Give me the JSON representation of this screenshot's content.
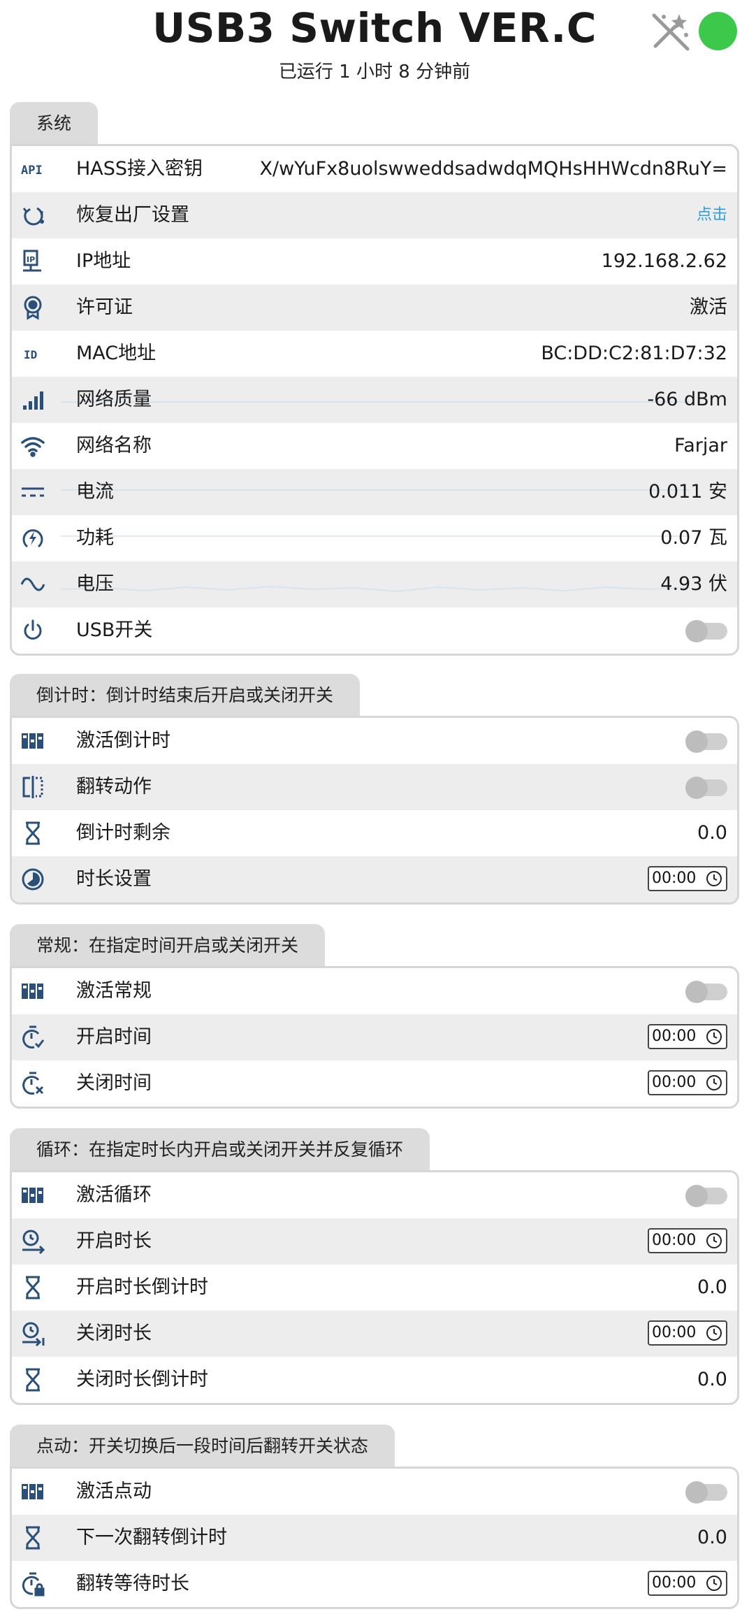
{
  "header": {
    "title": "USB3 Switch VER.C",
    "uptime": "已运行 1 小时 8 分钟前",
    "status_color": "#3cc84b"
  },
  "system": {
    "tab": "系统",
    "rows": [
      {
        "icon": "api-icon",
        "label": "HASS接入密钥",
        "value": "X/wYuFx8uolswweddsadwdqMQHsHHWcdn8RuY="
      },
      {
        "icon": "restore-icon",
        "label": "恢复出厂设置",
        "value": "点击"
      },
      {
        "icon": "ip-icon",
        "label": "IP地址",
        "value": "192.168.2.62"
      },
      {
        "icon": "license-icon",
        "label": "许可证",
        "value": "激活"
      },
      {
        "icon": "id-icon",
        "label": "MAC地址",
        "value": "BC:DD:C2:81:D7:32"
      },
      {
        "icon": "signal-icon",
        "label": "网络质量",
        "value": "-66 dBm"
      },
      {
        "icon": "wifi-icon",
        "label": "网络名称",
        "value": "Farjar"
      },
      {
        "icon": "current-icon",
        "label": "电流",
        "value": "0.011 安"
      },
      {
        "icon": "power-icon",
        "label": "功耗",
        "value": "0.07 瓦"
      },
      {
        "icon": "voltage-icon",
        "label": "电压",
        "value": "4.93 伏"
      },
      {
        "icon": "power-button-icon",
        "label": "USB开关"
      }
    ]
  },
  "countdown": {
    "tab": "倒计时：倒计时结束后开启或关闭开关",
    "rows": [
      {
        "icon": "activate-icon",
        "label": "激活倒计时"
      },
      {
        "icon": "flip-icon",
        "label": "翻转动作"
      },
      {
        "icon": "hourglass-icon",
        "label": "倒计时剩余",
        "value": "0.0"
      },
      {
        "icon": "duration-icon",
        "label": "时长设置",
        "time": "00:00"
      }
    ]
  },
  "schedule": {
    "tab": "常规：在指定时间开启或关闭开关",
    "rows": [
      {
        "icon": "activate-icon",
        "label": "激活常规"
      },
      {
        "icon": "timer-on-icon",
        "label": "开启时间",
        "time": "00:00"
      },
      {
        "icon": "timer-off-icon",
        "label": "关闭时间",
        "time": "00:00"
      }
    ]
  },
  "cycle": {
    "tab": "循环：在指定时长内开启或关闭开关并反复循环",
    "rows": [
      {
        "icon": "activate-icon",
        "label": "激活循环"
      },
      {
        "icon": "clock-on-icon",
        "label": "开启时长",
        "time": "00:00"
      },
      {
        "icon": "hourglass-icon",
        "label": "开启时长倒计时",
        "value": "0.0"
      },
      {
        "icon": "clock-off-icon",
        "label": "关闭时长",
        "time": "00:00"
      },
      {
        "icon": "hourglass-icon",
        "label": "关闭时长倒计时",
        "value": "0.0"
      }
    ]
  },
  "inching": {
    "tab": "点动：开关切换后一段时间后翻转开关状态",
    "rows": [
      {
        "icon": "activate-icon",
        "label": "激活点动"
      },
      {
        "icon": "hourglass-icon",
        "label": "下一次翻转倒计时",
        "value": "0.0"
      },
      {
        "icon": "timer-lock-icon",
        "label": "翻转等待时长",
        "time": "00:00"
      }
    ]
  }
}
